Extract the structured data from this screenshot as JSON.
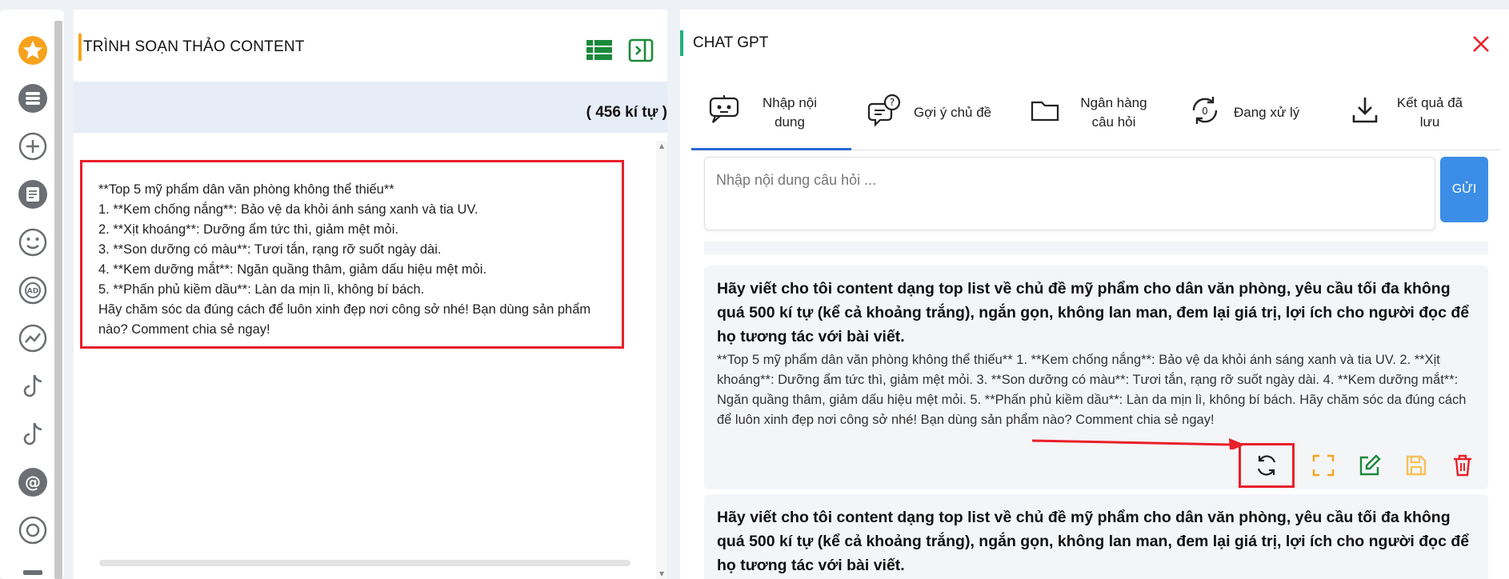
{
  "editor": {
    "title": "TRÌNH SOẠN THẢO CONTENT",
    "char_count": "( 456 kí tự )",
    "lines": [
      "**Top 5 mỹ phẩm dân văn phòng không thể thiếu**",
      "1. **Kem chống nắng**: Bảo vệ da khỏi ánh sáng xanh và tia UV.",
      "2. **Xịt khoáng**: Dưỡng ẩm tức thì, giảm mệt mỏi.",
      "3. **Son dưỡng có màu**: Tươi tắn, rạng rỡ suốt ngày dài.",
      "4. **Kem dưỡng mắt**: Ngăn quầng thâm, giảm dấu hiệu mệt mỏi.",
      "5. **Phấn phủ kiềm dầu**: Làn da mịn lì, không bí bách.",
      "Hãy chăm sóc da đúng cách để luôn xinh đẹp nơi công sở nhé! Bạn dùng sản phẩm nào? Comment chia sẻ ngay!"
    ]
  },
  "chat": {
    "title": "CHAT GPT",
    "tabs": [
      {
        "label": "Nhập nội dung",
        "icon": "chat-bot-icon"
      },
      {
        "label": "Gợi ý chủ đề",
        "icon": "question-bubble-icon"
      },
      {
        "label": "Ngân hàng câu hỏi",
        "icon": "folder-icon"
      },
      {
        "label": "Đang xử lý",
        "icon": "processing-icon"
      },
      {
        "label": "Kết quả đã lưu",
        "icon": "download-icon"
      }
    ],
    "processing_count": "0",
    "question_placeholder": "Nhập nội dung câu hỏi ...",
    "send_label": "GỬI",
    "cards": [
      {
        "question": "Hãy viết cho tôi content dạng top list về chủ đề mỹ phẩm cho dân văn phòng, yêu cầu tối đa không quá 500 kí tự (kể cả khoảng trắng), ngắn gọn, không lan man, đem lại giá trị, lợi ích cho người đọc để họ tương tác với bài viết.",
        "answer": "**Top 5 mỹ phẩm dân văn phòng không thể thiếu** 1. **Kem chống nắng**: Bảo vệ da khỏi ánh sáng xanh và tia UV. 2. **Xịt khoáng**: Dưỡng ẩm tức thì, giảm mệt mỏi. 3. **Son dưỡng có màu**: Tươi tắn, rạng rỡ suốt ngày dài. 4. **Kem dưỡng mắt**: Ngăn quầng thâm, giảm dấu hiệu mệt mỏi. 5. **Phấn phủ kiềm dầu**: Làn da mịn lì, không bí bách. Hãy chăm sóc da đúng cách để luôn xinh đẹp nơi công sở nhé! Bạn dùng sản phẩm nào? Comment chia sẻ ngay!"
      },
      {
        "question": "Hãy viết cho tôi content dạng top list về chủ đề mỹ phẩm cho dân văn phòng, yêu cầu tối đa không quá 500 kí tự (kể cả khoảng trắng), ngắn gọn, không lan man, đem lại giá trị, lợi ích cho người đọc để họ tương tác với bài viết."
      }
    ]
  },
  "colors": {
    "accent_orange": "#f4a51c",
    "accent_green": "#1fb07a",
    "primary_blue": "#3b8de6",
    "highlight_red": "#e8202a"
  }
}
